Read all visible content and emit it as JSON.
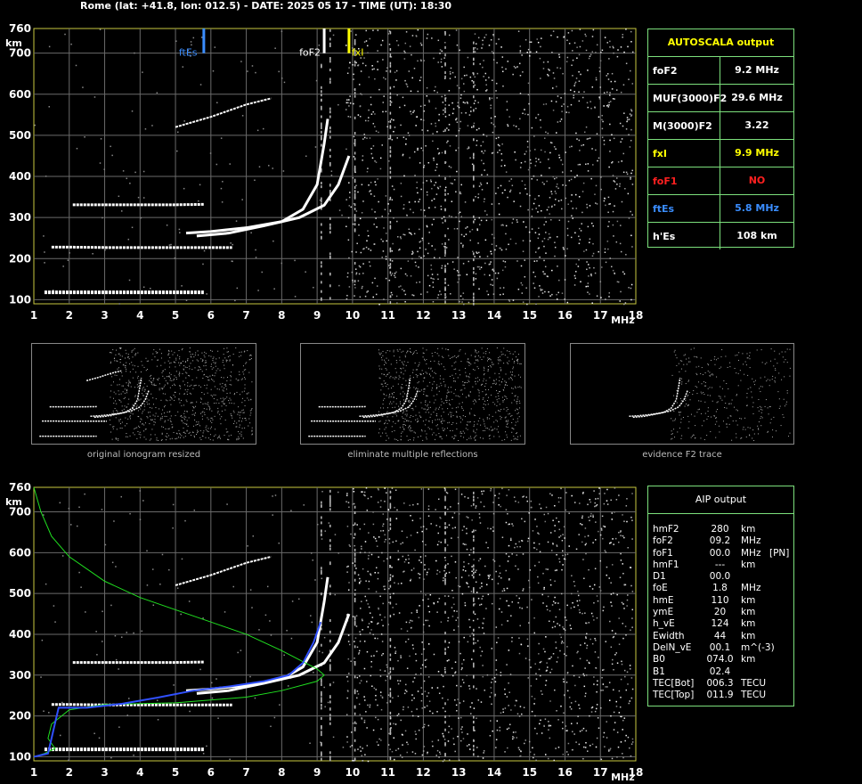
{
  "header": {
    "title": "Rome (lat: +41.8, lon: 012.5) - DATE: 2025 05 17 - TIME (UT): 18:30"
  },
  "chart_data": [
    {
      "type": "scatter",
      "name": "main-ionogram",
      "x": {
        "label": "MHz",
        "min": 1,
        "max": 18,
        "ticks": [
          "1",
          "2",
          "3",
          "4",
          "5",
          "6",
          "7",
          "8",
          "9",
          "10",
          "11",
          "12",
          "13",
          "14",
          "15",
          "16",
          "17",
          "18"
        ]
      },
      "y": {
        "label": "km",
        "min": 90,
        "max": 760,
        "ticks": [
          "100",
          "200",
          "300",
          "400",
          "500",
          "600",
          "700",
          "760"
        ]
      },
      "grid": true,
      "markers": [
        {
          "label": "ftEs",
          "freq": 5.8,
          "color": "#3a8dff"
        },
        {
          "label": "foF2",
          "freq": 9.2,
          "color": "#ffffff"
        },
        {
          "label": "fxI",
          "freq": 9.9,
          "color": "#ffff00"
        }
      ],
      "traces": [
        {
          "name": "Es",
          "points": [
            [
              1.3,
              118
            ],
            [
              2,
              118
            ],
            [
              3,
              118
            ],
            [
              4,
              118
            ],
            [
              5,
              118
            ],
            [
              5.5,
              118
            ],
            [
              5.8,
              118
            ]
          ]
        },
        {
          "name": "Es-2",
          "points": [
            [
              1.5,
              228
            ],
            [
              2,
              228
            ],
            [
              3,
              227
            ],
            [
              4,
              227
            ],
            [
              5,
              227
            ],
            [
              6,
              227
            ],
            [
              6.6,
              227
            ]
          ]
        },
        {
          "name": "Es-3",
          "points": [
            [
              2.1,
              331
            ],
            [
              3,
              331
            ],
            [
              4,
              331
            ],
            [
              5,
              331
            ],
            [
              5.8,
              332
            ]
          ]
        },
        {
          "name": "F2-o",
          "points": [
            [
              5.3,
              262
            ],
            [
              6,
              266
            ],
            [
              7,
              275
            ],
            [
              8,
              290
            ],
            [
              8.6,
              320
            ],
            [
              9,
              380
            ],
            [
              9.2,
              480
            ],
            [
              9.3,
              540
            ]
          ]
        },
        {
          "name": "F2-x",
          "points": [
            [
              5.6,
              255
            ],
            [
              6.5,
              262
            ],
            [
              7.5,
              280
            ],
            [
              8.5,
              300
            ],
            [
              9.2,
              330
            ],
            [
              9.6,
              380
            ],
            [
              9.9,
              450
            ]
          ]
        },
        {
          "name": "multiple",
          "points": [
            [
              5,
              520
            ],
            [
              6,
              545
            ],
            [
              7,
              575
            ],
            [
              7.7,
              590
            ]
          ]
        }
      ]
    },
    {
      "type": "scatter",
      "name": "aip-ionogram",
      "x": {
        "label": "MHz",
        "min": 1,
        "max": 18,
        "ticks": [
          "1",
          "2",
          "3",
          "4",
          "5",
          "6",
          "7",
          "8",
          "9",
          "10",
          "11",
          "12",
          "13",
          "14",
          "15",
          "16",
          "17",
          "18"
        ]
      },
      "y": {
        "label": "km",
        "min": 90,
        "max": 760,
        "ticks": [
          "100",
          "200",
          "300",
          "400",
          "500",
          "600",
          "700",
          "760"
        ]
      },
      "grid": true,
      "profile_green": [
        [
          1.0,
          760
        ],
        [
          1.2,
          700
        ],
        [
          1.5,
          640
        ],
        [
          2,
          590
        ],
        [
          3,
          530
        ],
        [
          4,
          490
        ],
        [
          5,
          460
        ],
        [
          6,
          430
        ],
        [
          7,
          400
        ],
        [
          8,
          360
        ],
        [
          9,
          315
        ],
        [
          9.2,
          300
        ],
        [
          9,
          285
        ],
        [
          8,
          262
        ],
        [
          7,
          246
        ],
        [
          5,
          232
        ],
        [
          3,
          228
        ],
        [
          2,
          215
        ],
        [
          1.5,
          180
        ],
        [
          1.4,
          145
        ],
        [
          1.6,
          120
        ],
        [
          1.3,
          108
        ],
        [
          1.0,
          100
        ]
      ],
      "profile_blue": [
        [
          1.0,
          100
        ],
        [
          1.4,
          108
        ],
        [
          1.7,
          220
        ],
        [
          2.5,
          220
        ],
        [
          3.5,
          230
        ],
        [
          4.5,
          245
        ],
        [
          5.5,
          262
        ],
        [
          6.5,
          272
        ],
        [
          7.5,
          285
        ],
        [
          8.2,
          300
        ],
        [
          8.6,
          330
        ],
        [
          8.9,
          380
        ],
        [
          9.1,
          430
        ]
      ]
    }
  ],
  "thumbs": [
    {
      "caption": "original ionogram resized"
    },
    {
      "caption": "eliminate multiple reflections"
    },
    {
      "caption": "evidence F2 trace"
    }
  ],
  "autoscala": {
    "title": "AUTOSCALA output",
    "rows": [
      {
        "label": "foF2",
        "value": "9.2 MHz",
        "color": "#ffffff"
      },
      {
        "label": "MUF(3000)F2",
        "value": "29.6 MHz",
        "color": "#ffffff"
      },
      {
        "label": "M(3000)F2",
        "value": "3.22",
        "color": "#ffffff"
      },
      {
        "label": "fxI",
        "value": "9.9 MHz",
        "color": "#ffff00"
      },
      {
        "label": "foF1",
        "value": "NO",
        "color": "#ff2020"
      },
      {
        "label": "ftEs",
        "value": "5.8 MHz",
        "color": "#3a8dff"
      },
      {
        "label": "h'Es",
        "value": "108     km",
        "color": "#ffffff"
      }
    ]
  },
  "aip": {
    "title": "AIP output",
    "rows": [
      [
        "hmF2",
        "280",
        "km",
        ""
      ],
      [
        "foF2",
        "09.2",
        "MHz",
        ""
      ],
      [
        "foF1",
        "00.0",
        "MHz",
        "[PN]"
      ],
      [
        "hmF1",
        "---",
        "km",
        ""
      ],
      [
        "D1",
        "00.0",
        "",
        ""
      ],
      [
        "foE",
        "1.8",
        "MHz",
        ""
      ],
      [
        "hmE",
        "110",
        "km",
        ""
      ],
      [
        "ymE",
        "20",
        "km",
        ""
      ],
      [
        "h_vE",
        "124",
        "km",
        ""
      ],
      [
        "Ewidth",
        "44",
        "km",
        ""
      ],
      [
        "DelN_vE",
        "00.1",
        "m^(-3)",
        ""
      ],
      [
        "B0",
        "074.0",
        "km",
        ""
      ],
      [
        "B1",
        "02.4",
        "",
        ""
      ],
      [
        "TEC[Bot]",
        "006.3",
        "TECU",
        ""
      ],
      [
        "TEC[Top]",
        "011.9",
        "TECU",
        ""
      ]
    ]
  }
}
